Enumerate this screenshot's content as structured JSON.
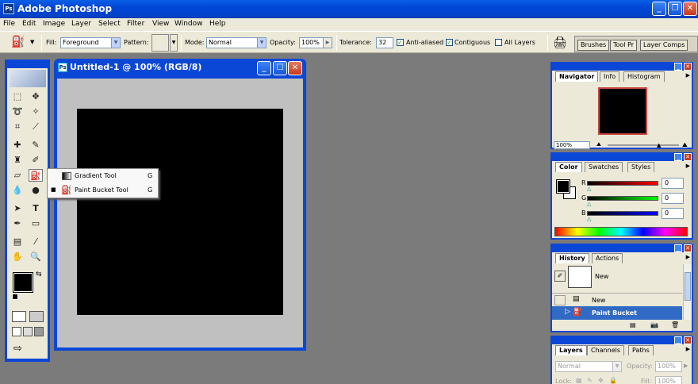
{
  "app": {
    "title": "Adobe Photoshop",
    "icon_letters": "Ps"
  },
  "menubar": [
    "File",
    "Edit",
    "Image",
    "Layer",
    "Select",
    "Filter",
    "View",
    "Window",
    "Help"
  ],
  "options_bar": {
    "fill_label": "Fill:",
    "fill_value": "Foreground",
    "pattern_label": "Pattern:",
    "mode_label": "Mode:",
    "mode_value": "Normal",
    "opacity_label": "Opacity:",
    "opacity_value": "100%",
    "tolerance_label": "Tolerance:",
    "tolerance_value": "32",
    "anti_aliased_label": "Anti-aliased",
    "contiguous_label": "Contiguous",
    "all_layers_label": "All Layers",
    "well_tabs": [
      "Brushes",
      "Tool Pr",
      "Layer Comps"
    ]
  },
  "document": {
    "title": "Untitled-1 @ 100% (RGB/8)",
    "canvas_color": "#000000"
  },
  "tool_flyout": {
    "items": [
      {
        "label": "Gradient Tool",
        "shortcut": "G",
        "active": false
      },
      {
        "label": "Paint Bucket Tool",
        "shortcut": "G",
        "active": true
      }
    ]
  },
  "panels": {
    "navigator": {
      "tabs": [
        "Navigator",
        "Info",
        "Histogram"
      ],
      "zoom": "100%"
    },
    "color": {
      "tabs": [
        "Color",
        "Swatches",
        "Styles"
      ],
      "channels": [
        {
          "label": "R",
          "value": "0",
          "color": "#cc0000"
        },
        {
          "label": "G",
          "value": "0",
          "color": "#00aa00"
        },
        {
          "label": "B",
          "value": "0",
          "color": "#0000cc"
        }
      ]
    },
    "history": {
      "tabs": [
        "History",
        "Actions"
      ],
      "snapshot_label": "New",
      "items": [
        {
          "label": "New",
          "active": false
        },
        {
          "label": "Paint Bucket",
          "active": true
        }
      ]
    },
    "layers": {
      "tabs": [
        "Layers",
        "Channels",
        "Paths"
      ],
      "blend_mode": "Normal",
      "opacity_label": "Opacity:",
      "opacity_value": "100%",
      "lock_label": "Lock:",
      "fill_label": "Fill:",
      "fill_value": "100%"
    }
  },
  "colors": {
    "xp_blue": "#0a47d6",
    "chrome": "#ece9d8",
    "workspace": "#7b7b7b",
    "foreground": "#000000",
    "background": "#ffffff"
  }
}
